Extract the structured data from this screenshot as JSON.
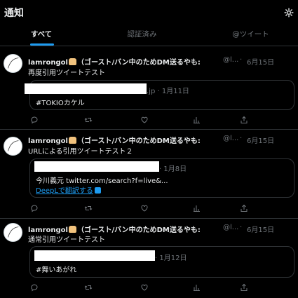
{
  "header": {
    "title": "通知",
    "settings_icon": "gear-icon",
    "tabs": [
      {
        "label": "すべて",
        "active": true
      },
      {
        "label": "認証済み",
        "active": false
      },
      {
        "label": "@ツイート",
        "active": false
      }
    ]
  },
  "colors": {
    "accent": "#1d9bf0",
    "background": "#000000",
    "text": "#e7e9ea",
    "muted": "#71767b",
    "border": "#2f3336"
  },
  "tweets": [
    {
      "author_name": "lamrongol",
      "author_emoji_icon": "bread-icon",
      "author_suffix": "（ゴースト/バン中のためDM送るやも:",
      "handle": "@l...",
      "date": "6月15日",
      "text": "再度引用ツイートテスト",
      "quote": {
        "meta": ".jp · 1月11日",
        "text": "#TOKIOカケル"
      }
    },
    {
      "author_name": "lamrongol",
      "author_emoji_icon": "bread-icon",
      "author_suffix": "（ゴースト/バン中のためDM送るやも:",
      "handle": "@l...",
      "date": "6月15日",
      "text": "URLによる引用ツイートテスト２",
      "quote": {
        "meta": "· 1月8日",
        "text": "今川義元 twitter.com/search?f=live&...",
        "translate_label": "DeepLで翻訳する"
      }
    },
    {
      "author_name": "lamrongol",
      "author_emoji_icon": "bread-icon",
      "author_suffix": "（ゴースト/バン中のためDM送るやも:",
      "handle": "@l...",
      "date": "6月15日",
      "text": "通常引用ツイートテスト",
      "quote": {
        "meta": "· 1月12日",
        "text": "#舞いあがれ"
      }
    }
  ],
  "action_icons": [
    "reply-icon",
    "retweet-icon",
    "like-icon",
    "views-icon",
    "share-icon"
  ]
}
